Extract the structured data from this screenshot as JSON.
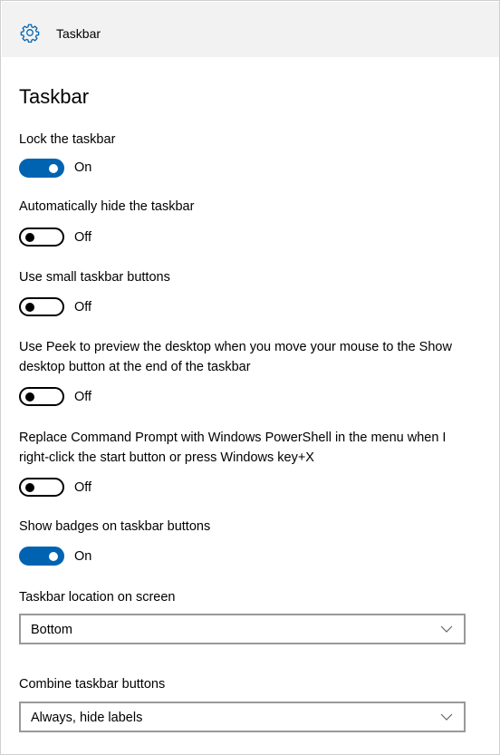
{
  "window": {
    "title": "Taskbar"
  },
  "page": {
    "title": "Taskbar"
  },
  "settings": [
    {
      "label": "Lock the taskbar",
      "state": "On",
      "checked": true
    },
    {
      "label": "Automatically hide the taskbar",
      "state": "Off",
      "checked": false
    },
    {
      "label": "Use small taskbar buttons",
      "state": "Off",
      "checked": false
    },
    {
      "label": "Use Peek to preview the desktop when you move your mouse to the Show desktop button at the end of the taskbar",
      "state": "Off",
      "checked": false
    },
    {
      "label": "Replace Command Prompt with Windows PowerShell in the menu when I right-click the start button or press Windows key+X",
      "state": "Off",
      "checked": false
    },
    {
      "label": "Show badges on taskbar buttons",
      "state": "On",
      "checked": true
    }
  ],
  "dropdowns": [
    {
      "label": "Taskbar location on screen",
      "value": "Bottom"
    },
    {
      "label": "Combine taskbar buttons",
      "value": "Always, hide labels"
    }
  ],
  "icons": {
    "title_icon": "gear-icon",
    "dropdown_icon": "chevron-down-icon"
  },
  "colors": {
    "accent": "#0063b1",
    "titlebar_bg": "#f2f2f2",
    "toggle_off_border": "#000000",
    "dropdown_border": "#999999"
  }
}
